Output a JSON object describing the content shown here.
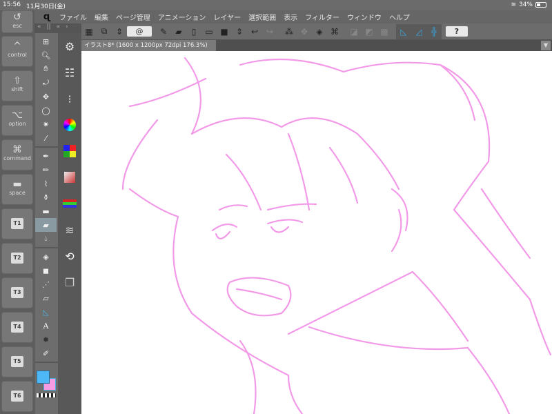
{
  "status": {
    "time": "15:56",
    "date": "11月30日(金)",
    "battery": "34%",
    "battery_level": 0.34
  },
  "keys": [
    {
      "glyph": "↺",
      "label": "esc"
    },
    {
      "glyph": "^",
      "label": "control"
    },
    {
      "glyph": "⇧",
      "label": "shift"
    },
    {
      "glyph": "⌥",
      "label": "option"
    },
    {
      "glyph": "⌘",
      "label": "command"
    },
    {
      "glyph": "▬",
      "label": "space"
    }
  ],
  "tkeys": [
    "T1",
    "T2",
    "T3",
    "T4",
    "T5",
    "T6"
  ],
  "menu": {
    "logo": "ɋ",
    "items": [
      "ファイル",
      "編集",
      "ページ管理",
      "アニメーション",
      "レイヤー",
      "選択範囲",
      "表示",
      "フィルター",
      "ウィンドウ",
      "ヘルプ"
    ]
  },
  "panelbar": {
    "collapse_left": "«",
    "divider": "||",
    "collapse_left2": "«",
    "expand": "›"
  },
  "toolbar": {
    "help_label": "?"
  },
  "document": {
    "tab_title": "イラスト8* (1600 x 1200px 72dpi 176.3%)"
  },
  "colors": {
    "main": "#4db8f5",
    "sub": "#f59be3",
    "sketch": "#f29ae8"
  }
}
